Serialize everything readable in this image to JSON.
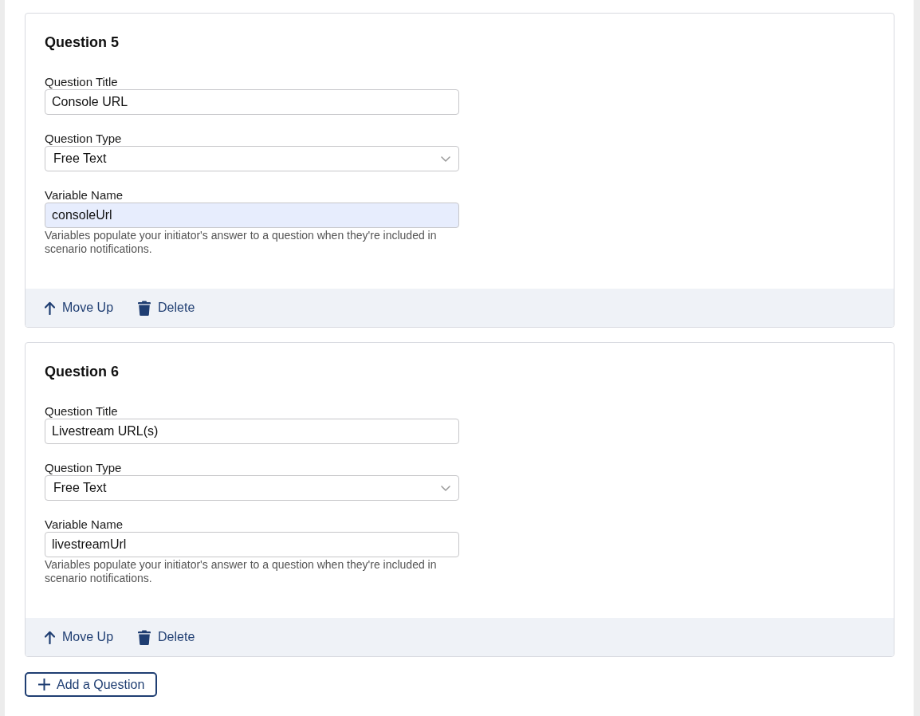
{
  "questions": [
    {
      "heading": "Question 5",
      "fields": [
        {
          "kind": "text",
          "label": "Question Title",
          "value": "Console URL",
          "highlighted": false
        },
        {
          "kind": "select",
          "label": "Question Type",
          "value": "Free Text",
          "highlighted": false
        },
        {
          "kind": "text",
          "label": "Variable Name",
          "value": "consoleUrl",
          "highlighted": true,
          "help": "Variables populate your initiator's answer to a question when they're included in scenario notifications."
        }
      ],
      "actions": [
        {
          "kind": "move_up",
          "label": "Move Up"
        },
        {
          "kind": "delete",
          "label": "Delete"
        }
      ]
    },
    {
      "heading": "Question 6",
      "fields": [
        {
          "kind": "text",
          "label": "Question Title",
          "value": "Livestream URL(s)",
          "highlighted": false
        },
        {
          "kind": "select",
          "label": "Question Type",
          "value": "Free Text",
          "highlighted": false
        },
        {
          "kind": "text",
          "label": "Variable Name",
          "value": "livestreamUrl",
          "highlighted": false,
          "help": "Variables populate your initiator's answer to a question when they're included in scenario notifications."
        }
      ],
      "actions": [
        {
          "kind": "move_up",
          "label": "Move Up"
        },
        {
          "kind": "delete",
          "label": "Delete"
        }
      ]
    }
  ],
  "add_button": {
    "label": "Add a Question"
  }
}
